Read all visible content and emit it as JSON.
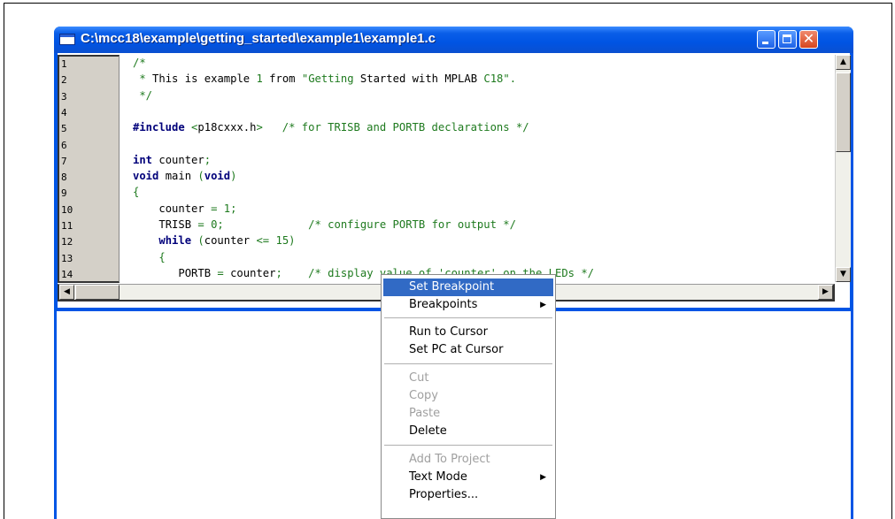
{
  "window": {
    "title": "C:\\mcc18\\example\\getting_started\\example1\\example1.c"
  },
  "title_buttons": {
    "minimize": "minimize-icon",
    "maximize": "maximize-icon",
    "close": "close-icon",
    "close_glyph": "✕"
  },
  "editor": {
    "line_numbers": [
      "1",
      "2",
      "3",
      "4",
      "5",
      "6",
      "7",
      "8",
      "9",
      "10",
      "11",
      "12",
      "13",
      "14"
    ],
    "lines": [
      "/*",
      " * This is example 1 from \"Getting Started with MPLAB C18\".",
      " */",
      "",
      "#include <p18cxxx.h>   /* for TRISB and PORTB declarations */",
      "",
      "int counter;",
      "void main (void)",
      "{",
      "    counter = 1;",
      "    TRISB = 0;             /* configure PORTB for output */",
      "    while (counter <= 15)",
      "    {",
      "       PORTB = counter;    /* display value of 'counter' on the LEDs */"
    ]
  },
  "scrollbars": {
    "up_arrow": "▲",
    "down_arrow": "▼",
    "left_arrow": "◀",
    "right_arrow": "▶"
  },
  "context_menu": {
    "items": [
      {
        "label": "Set Breakpoint",
        "selected": true,
        "disabled": false
      },
      {
        "label": "Breakpoints",
        "submenu": true,
        "disabled": false
      },
      {
        "label": "Run to Cursor",
        "disabled": false
      },
      {
        "label": "Set PC at Cursor",
        "disabled": false
      },
      {
        "label": "Cut",
        "disabled": true
      },
      {
        "label": "Copy",
        "disabled": true
      },
      {
        "label": "Paste",
        "disabled": true
      },
      {
        "label": "Delete",
        "disabled": false
      },
      {
        "label": "Add To Project",
        "disabled": true
      },
      {
        "label": "Text Mode",
        "submenu": true,
        "disabled": false
      },
      {
        "label": "Properties...",
        "disabled": false
      }
    ],
    "submenu_arrow": "▶"
  },
  "colors": {
    "title_bar": "#0054e3",
    "selection": "#316ac5",
    "comment_text": "#1e7a1e",
    "keyword_text": "#00007a"
  }
}
